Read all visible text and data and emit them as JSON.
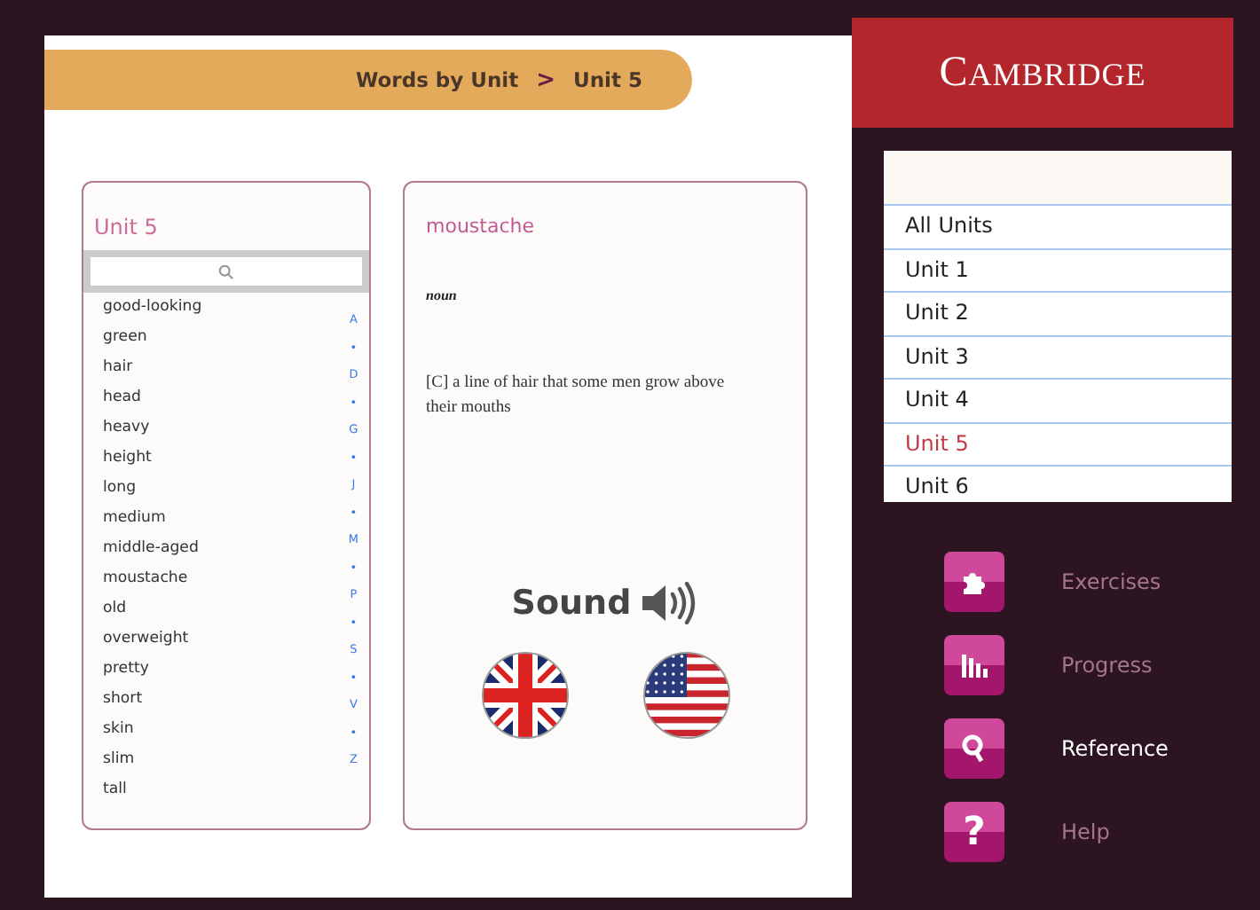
{
  "breadcrumb": {
    "items": [
      "Words by Unit",
      "Unit 5"
    ],
    "separator": ">"
  },
  "word_list": {
    "title": "Unit 5",
    "words": [
      "good-looking",
      "green",
      "hair",
      "head",
      "heavy",
      "height",
      "long",
      "medium",
      "middle-aged",
      "moustache",
      "old",
      "overweight",
      "pretty",
      "short",
      "skin",
      "slim",
      "tall"
    ],
    "index": [
      "A",
      "•",
      "D",
      "•",
      "G",
      "•",
      "J",
      "•",
      "M",
      "•",
      "P",
      "•",
      "S",
      "•",
      "V",
      "•",
      "Z"
    ]
  },
  "entry": {
    "headword": "moustache",
    "part_of_speech": "noun",
    "definition": "[C] a line of hair that some men grow above their mouths",
    "sound_label": "Sound",
    "pronunciations": [
      {
        "kind": "uk"
      },
      {
        "kind": "us"
      }
    ]
  },
  "logo": "CAMBRIDGE",
  "units": [
    {
      "label": "All Units",
      "selected": false
    },
    {
      "label": "Unit 1",
      "selected": false
    },
    {
      "label": "Unit 2",
      "selected": false
    },
    {
      "label": "Unit 3",
      "selected": false
    },
    {
      "label": "Unit 4",
      "selected": false
    },
    {
      "label": "Unit 5",
      "selected": true
    },
    {
      "label": "Unit 6",
      "selected": false
    }
  ],
  "nav": [
    {
      "kind": "puzzle",
      "label": "Exercises",
      "selected": false
    },
    {
      "kind": "bars",
      "label": "Progress",
      "selected": false
    },
    {
      "kind": "search",
      "label": "Reference",
      "selected": true
    },
    {
      "kind": "help",
      "label": "Help",
      "icon_text": "?",
      "selected": false
    }
  ]
}
